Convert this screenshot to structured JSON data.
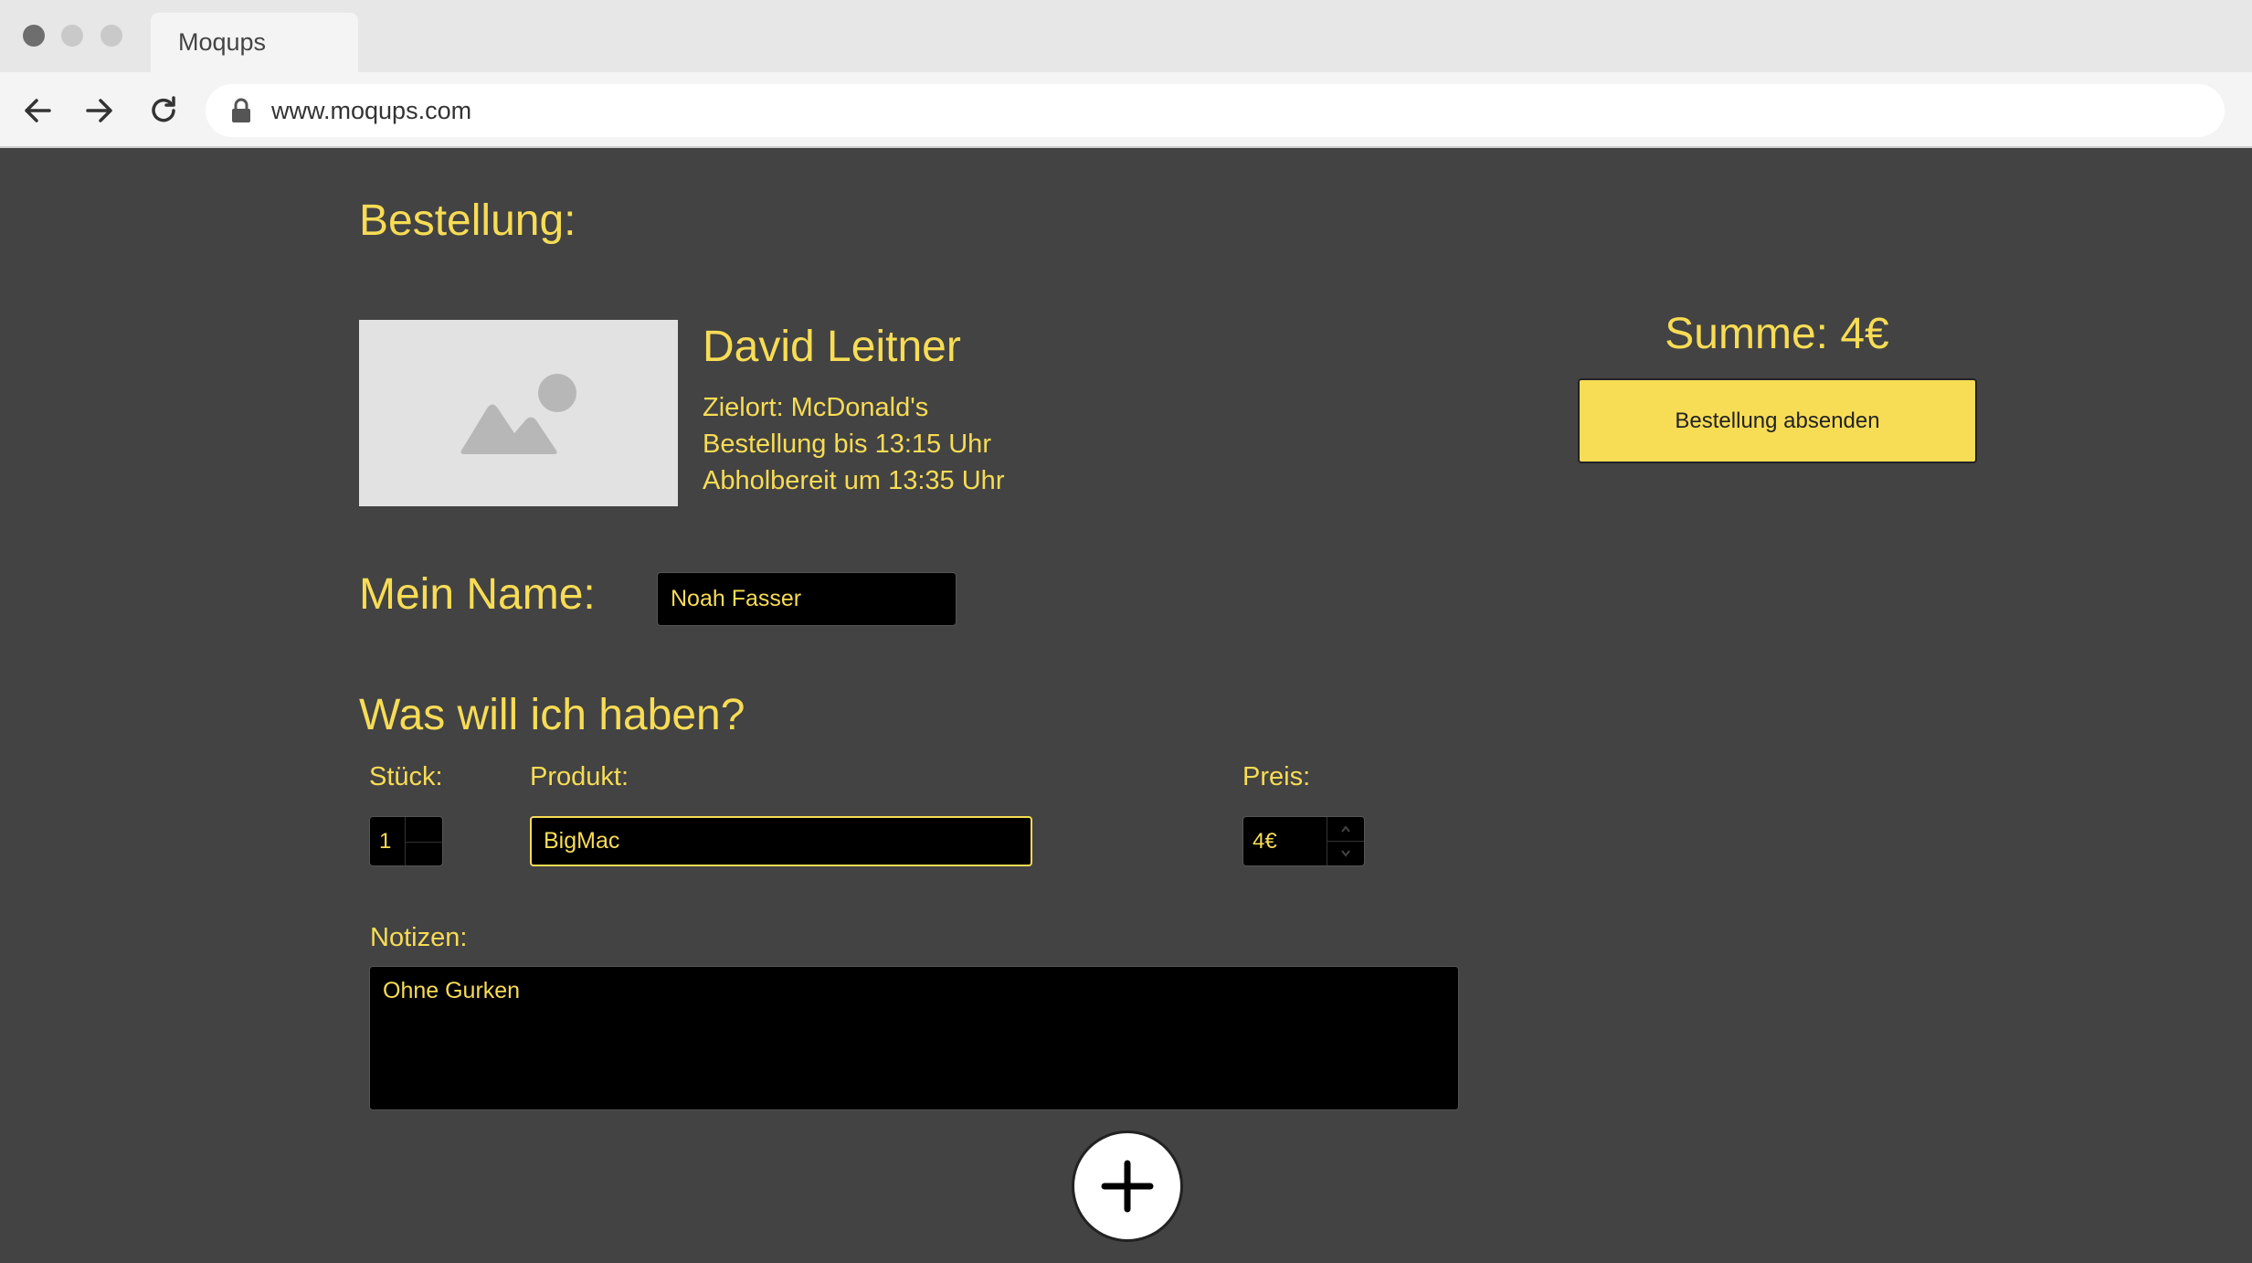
{
  "browser": {
    "tab_title": "Moqups",
    "url": "www.moqups.com",
    "icons": [
      "back-arrow-icon",
      "forward-arrow-icon",
      "reload-icon",
      "lock-icon"
    ]
  },
  "order": {
    "heading": "Bestellung:",
    "person_name": "David Leitner",
    "destination": "Zielort: McDonald's",
    "order_deadline": "Bestellung bis 13:15 Uhr",
    "pickup_time": "Abholbereit um 13:35 Uhr",
    "sum": "Summe: 4€",
    "submit_label": "Bestellung absenden"
  },
  "my_name": {
    "label": "Mein Name:",
    "value": "Noah Fasser"
  },
  "item": {
    "heading": "Was will ich haben?",
    "qty_label": "Stück:",
    "product_label": "Produkt:",
    "price_label": "Preis:",
    "qty_value": "1",
    "product_value": "BigMac",
    "price_value": "4€",
    "notes_label": "Notizen:",
    "notes_value": "Ohne Gurken"
  },
  "colors": {
    "background": "#434343",
    "accent": "#f7dc55",
    "input_bg": "#000000"
  }
}
